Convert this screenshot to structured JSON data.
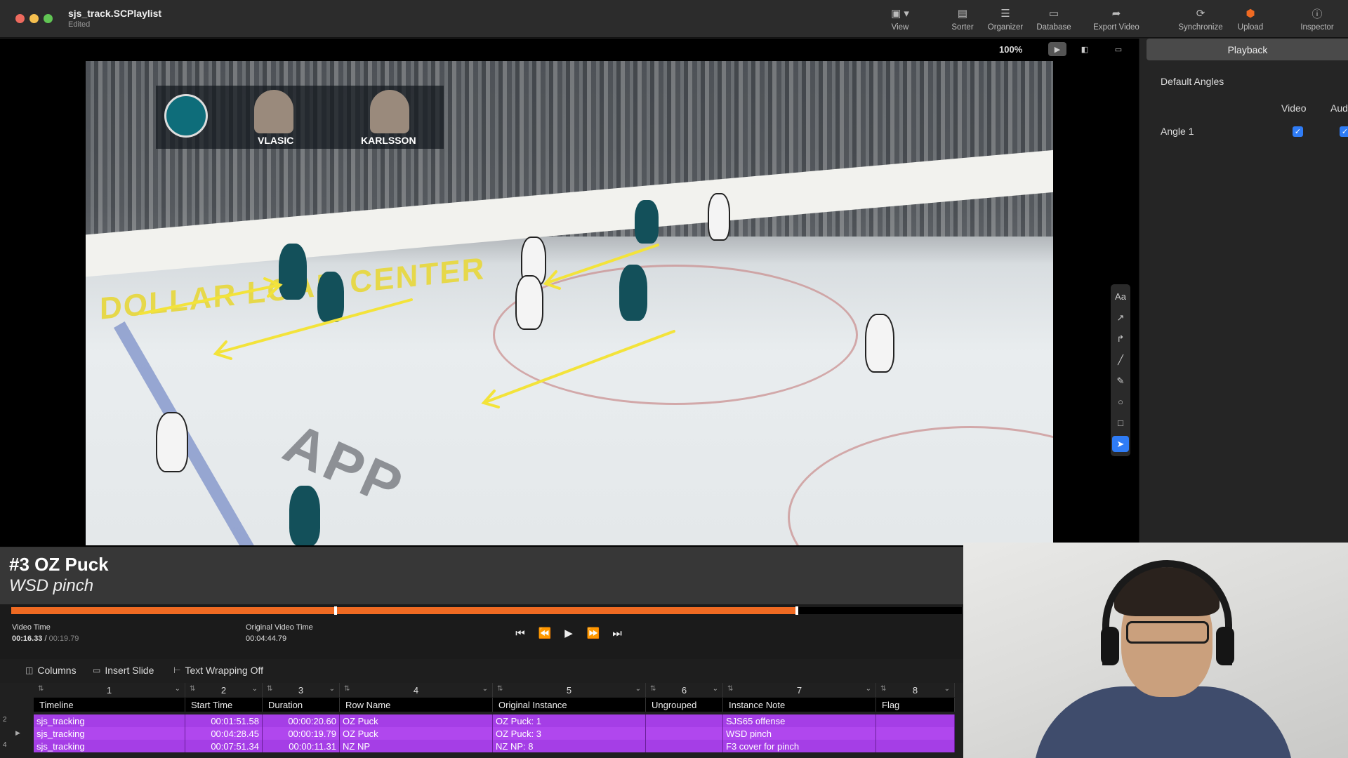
{
  "window": {
    "title": "sjs_track.SCPlaylist",
    "subtitle": "Edited"
  },
  "toolbar": {
    "items": [
      {
        "label": "View",
        "icon": "view-icon"
      },
      {
        "label": "Sorter",
        "icon": "sorter-icon"
      },
      {
        "label": "Organizer",
        "icon": "organizer-icon"
      },
      {
        "label": "Database",
        "icon": "database-icon"
      },
      {
        "label": "Export Video",
        "icon": "export-icon"
      },
      {
        "label": "Synchronize",
        "icon": "sync-icon"
      },
      {
        "label": "Upload",
        "icon": "upload-icon"
      },
      {
        "label": "Inspector",
        "icon": "info-icon"
      }
    ]
  },
  "video": {
    "zoom": "100%",
    "hud": {
      "player1": "VLASIC",
      "player2": "KARLSSON"
    },
    "boards_text": "DOLLAR LOAN CENTER",
    "ice_logo_text": "APP"
  },
  "caption": {
    "title": "#3 OZ Puck",
    "subtitle": "WSD pinch"
  },
  "transport": {
    "video_time_label": "Video Time",
    "video_time_current": "00:16.33",
    "video_time_total": "00:19.79",
    "original_time_label": "Original Video Time",
    "original_time_value": "00:04:44.79",
    "progress_fraction": 0.825,
    "playhead_fraction": 0.34
  },
  "table_toolbar": {
    "columns": "Columns",
    "insert_slide": "Insert Slide",
    "text_wrapping": "Text Wrapping Off"
  },
  "table": {
    "column_numbers": [
      "1",
      "2",
      "3",
      "4",
      "5",
      "6",
      "7",
      "8"
    ],
    "headers": [
      "Timeline",
      "Start Time",
      "Duration",
      "Row Name",
      "Original Instance",
      "Ungrouped",
      "Instance Note",
      "Flag"
    ],
    "rows": [
      {
        "num": "2",
        "timeline": "sjs_tracking",
        "start": "00:01:51.58",
        "duration": "00:00:20.60",
        "row_name": "OZ Puck",
        "original": "OZ Puck: 1",
        "ungrouped": "",
        "note": "SJS65 offense",
        "flag": ""
      },
      {
        "num": "",
        "timeline": "sjs_tracking",
        "start": "00:04:28.45",
        "duration": "00:00:19.79",
        "row_name": "OZ Puck",
        "original": "OZ Puck: 3",
        "ungrouped": "",
        "note": "WSD pinch",
        "flag": ""
      },
      {
        "num": "4",
        "timeline": "sjs_tracking",
        "start": "00:07:51.34",
        "duration": "00:00:11.31",
        "row_name": "NZ NP",
        "original": "NZ NP: 8",
        "ungrouped": "",
        "note": "F3 cover for pinch",
        "flag": ""
      }
    ]
  },
  "right_panel": {
    "tab": "Playback",
    "heading": "Default Angles",
    "col_video": "Video",
    "col_audio": "Aud",
    "angle": "Angle 1"
  },
  "colors": {
    "progress": "#ef6a22",
    "row_purple": "#a53ee6",
    "accent_blue": "#2f7cf6"
  }
}
